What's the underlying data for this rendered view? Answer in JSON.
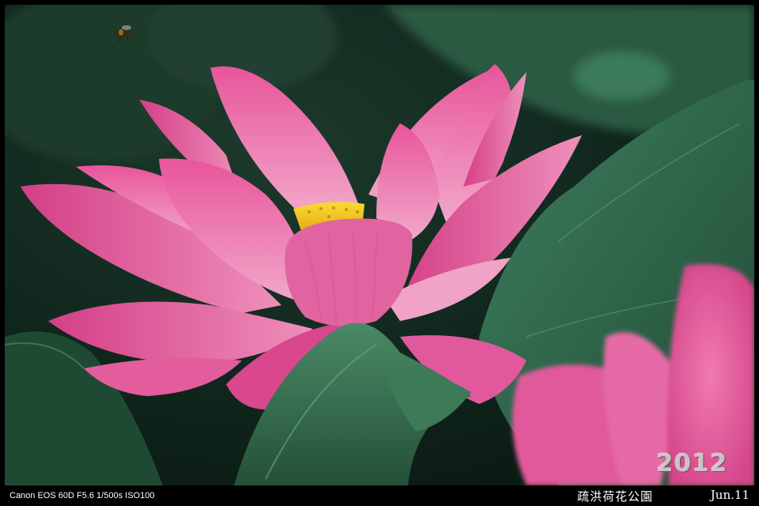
{
  "photo": {
    "subject": "pink lotus flower with yellow seed pod among green lotus leaves, bee in flight",
    "colors": {
      "frame": "#000000",
      "petal_pink": "#e0569a",
      "petal_light": "#f0a6c8",
      "seed_pod": "#f5d21f",
      "leaf_green": "#2f6b4c",
      "background_dark": "#0c2018"
    }
  },
  "watermark": {
    "year": "2012"
  },
  "captions": {
    "camera": "Canon EOS 60D  F5.6 1/500s ISO100",
    "location": "疏洪荷花公園",
    "date": "Jun.11"
  }
}
